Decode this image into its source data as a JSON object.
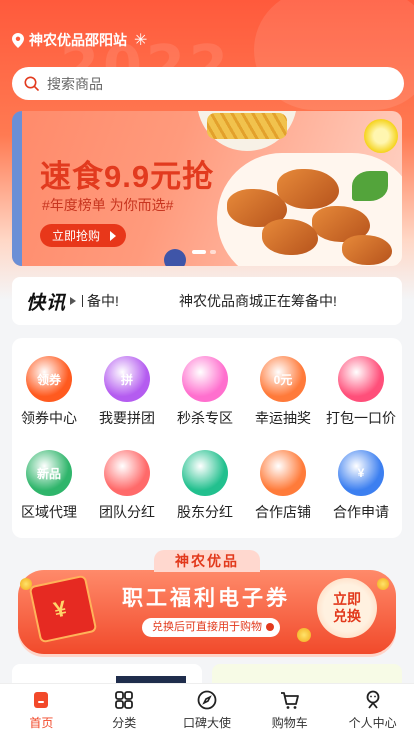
{
  "location": {
    "text": "神农优品邵阳站",
    "hero_year": "2022"
  },
  "search": {
    "placeholder": "搜索商品"
  },
  "banner": {
    "title": "速食9.9元抢",
    "subtitle": "#年度榜单 为你而选#",
    "cta": "立即抢购",
    "slide_count": 2,
    "active_slide": 1
  },
  "news": {
    "logo": "快讯",
    "ticker_fragment": "备中!",
    "ticker_text": "神农优品商城正在筹备中!"
  },
  "grid": [
    {
      "label": "领券中心",
      "icon": "coupon-icon",
      "color": "#ff5a1f",
      "badge": "领券"
    },
    {
      "label": "我要拼团",
      "icon": "group-buy-icon",
      "color": "#b45cf0",
      "badge": "拼"
    },
    {
      "label": "秒杀专区",
      "icon": "flash-sale-icon",
      "color": "#ff6fce",
      "badge": ""
    },
    {
      "label": "幸运抽奖",
      "icon": "lottery-icon",
      "color": "#ff7a3a",
      "badge": "0元"
    },
    {
      "label": "打包一口价",
      "icon": "bundle-price-icon",
      "color": "#ff4f7a",
      "badge": ""
    },
    {
      "label": "区域代理",
      "icon": "calendar-icon",
      "color": "#2fb56b",
      "badge": "新品"
    },
    {
      "label": "团队分红",
      "icon": "envelope-icon",
      "color": "#ff6a6a",
      "badge": ""
    },
    {
      "label": "股东分红",
      "icon": "person-icon",
      "color": "#22c08e",
      "badge": ""
    },
    {
      "label": "合作店铺",
      "icon": "shop-box-icon",
      "color": "#ff7b3a",
      "badge": ""
    },
    {
      "label": "合作申请",
      "icon": "shield-icon",
      "color": "#3c7ff0",
      "badge": "¥"
    }
  ],
  "promo": {
    "tab": "神农优品",
    "title": "职工福利电子券",
    "hint": "兑换后可直接用于购物",
    "redeem_line1": "立即",
    "redeem_line2": "兑换"
  },
  "tabbar": [
    {
      "label": "首页",
      "icon": "home-icon",
      "active": true
    },
    {
      "label": "分类",
      "icon": "category-grid-icon",
      "active": false
    },
    {
      "label": "口碑大使",
      "icon": "compass-icon",
      "active": false
    },
    {
      "label": "购物车",
      "icon": "cart-icon",
      "active": false
    },
    {
      "label": "个人中心",
      "icon": "profile-icon",
      "active": false
    }
  ],
  "colors": {
    "brand": "#ff5a3c",
    "accent": "#f2492a"
  }
}
